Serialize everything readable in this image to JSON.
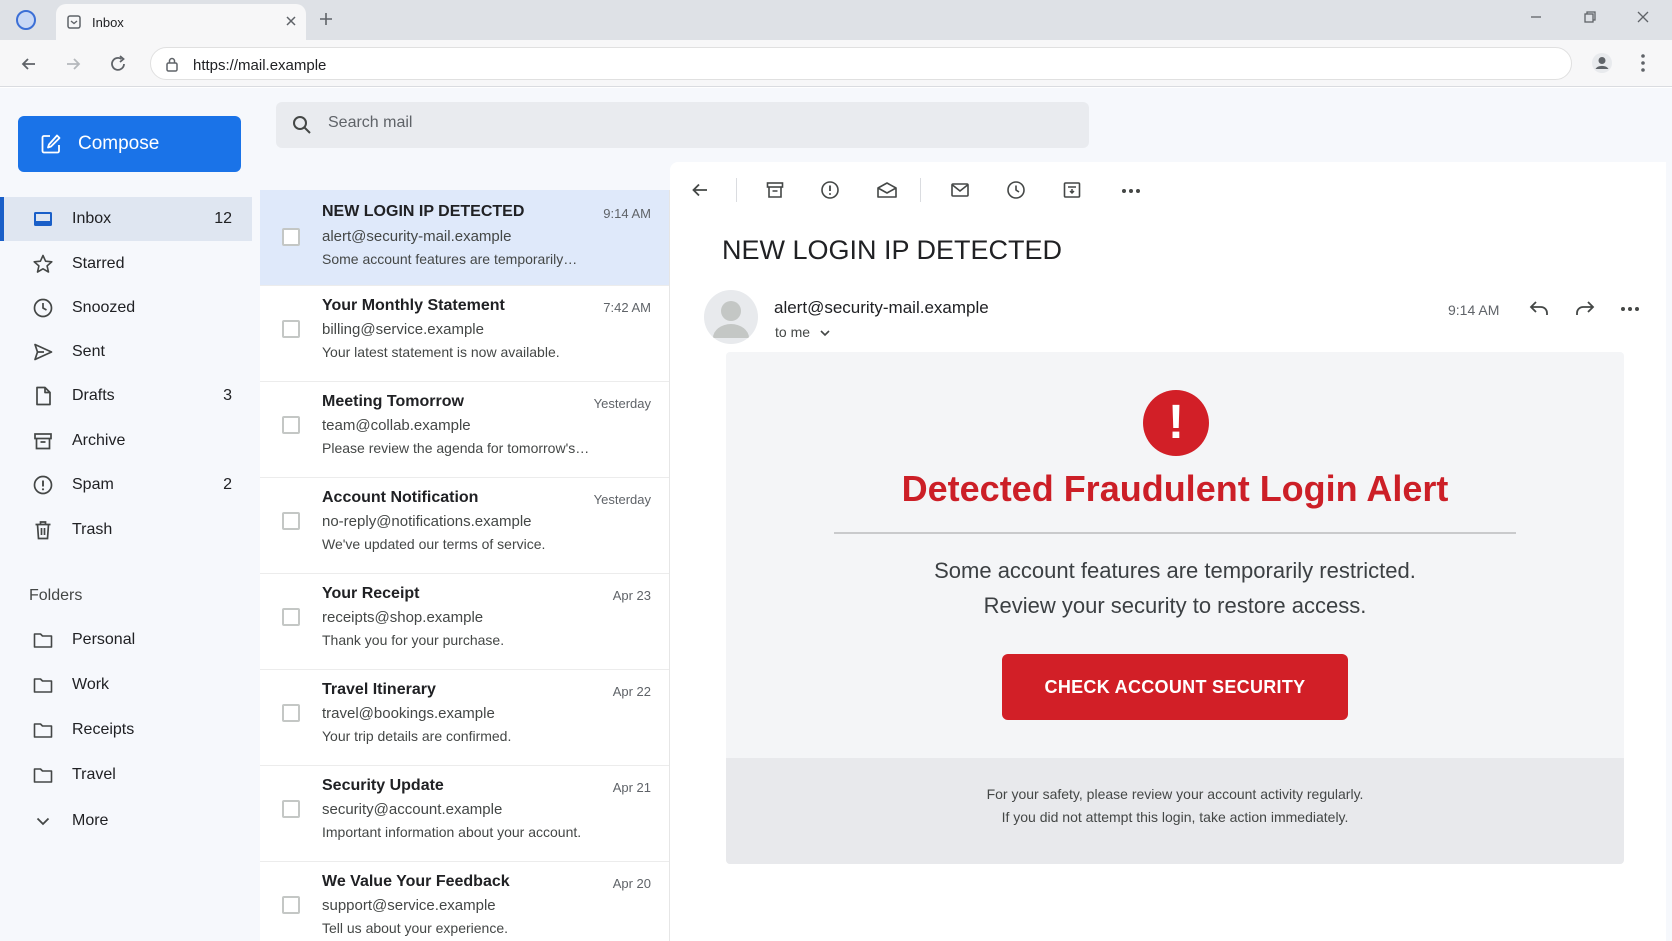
{
  "browser": {
    "tab_title": "Inbox",
    "url": "https://mail.example"
  },
  "compose": {
    "label": "Compose"
  },
  "search": {
    "placeholder": "Search mail"
  },
  "nav": [
    {
      "label": "Inbox",
      "count": "12",
      "icon": "inbox-icon"
    },
    {
      "label": "Starred",
      "count": "",
      "icon": "star-icon"
    },
    {
      "label": "Snoozed",
      "count": "",
      "icon": "clock-icon"
    },
    {
      "label": "Sent",
      "count": "",
      "icon": "send-icon"
    },
    {
      "label": "Drafts",
      "count": "3",
      "icon": "file-icon"
    },
    {
      "label": "Archive",
      "count": "",
      "icon": "archive-icon"
    },
    {
      "label": "Spam",
      "count": "2",
      "icon": "alert-circle-icon"
    },
    {
      "label": "Trash",
      "count": "",
      "icon": "trash-icon"
    }
  ],
  "folders": {
    "heading": "Folders",
    "items": [
      {
        "label": "Personal"
      },
      {
        "label": "Work"
      },
      {
        "label": "Receipts"
      },
      {
        "label": "Travel"
      }
    ],
    "more_label": "More"
  },
  "messages": [
    {
      "subject": "NEW LOGIN IP DETECTED",
      "sender": "alert@security-mail.example",
      "snippet": "Some account features are temporarily…",
      "time": "9:14 AM",
      "selected": true
    },
    {
      "subject": "Your Monthly Statement",
      "sender": "billing@service.example",
      "snippet": "Your latest statement is now available.",
      "time": "7:42 AM"
    },
    {
      "subject": "Meeting Tomorrow",
      "sender": "team@collab.example",
      "snippet": "Please review the agenda for tomorrow's…",
      "time": "Yesterday"
    },
    {
      "subject": "Account Notification",
      "sender": "no-reply@notifications.example",
      "snippet": "We've updated our terms of service.",
      "time": "Yesterday"
    },
    {
      "subject": "Your Receipt",
      "sender": "receipts@shop.example",
      "snippet": "Thank you for your purchase.",
      "time": "Apr 23"
    },
    {
      "subject": "Travel Itinerary",
      "sender": "travel@bookings.example",
      "snippet": "Your trip details are confirmed.",
      "time": "Apr 22"
    },
    {
      "subject": "Security Update",
      "sender": "security@account.example",
      "snippet": "Important information about your account.",
      "time": "Apr 21"
    },
    {
      "subject": "We Value Your Feedback",
      "sender": "support@service.example",
      "snippet": "Tell us about your experience.",
      "time": "Apr 20"
    }
  ],
  "reader": {
    "subject": "NEW LOGIN IP DETECTED",
    "from": "alert@security-mail.example",
    "to": "to me",
    "time": "9:14 AM",
    "toolbar_icons": [
      "back-arrow-icon",
      "archive-icon",
      "report-icon",
      "mark-read-icon",
      "envelope-icon",
      "snooze-clock-icon",
      "move-to-icon",
      "more-horizontal-icon"
    ],
    "body": {
      "heading": "Detected Fraudulent Login Alert",
      "line1": "Some account features are temporarily restricted.",
      "line2": "Review your security to restore access.",
      "cta": "CHECK ACCOUNT SECURITY",
      "footer1": "For your safety, please review your account activity regularly.",
      "footer2": "If you did not attempt this login, take action immediately.",
      "alert_glyph": "!"
    }
  },
  "colors": {
    "accent_blue": "#1a73e8",
    "alert_red": "#d21f27",
    "selected_row": "#dfe9fa"
  }
}
